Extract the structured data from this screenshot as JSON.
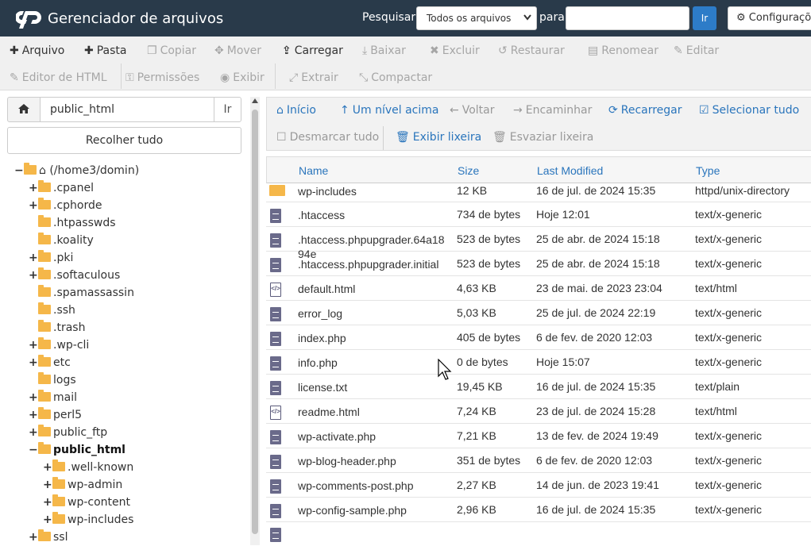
{
  "header": {
    "app_title": "Gerenciador de arquivos",
    "search_label": "Pesquisar",
    "search_scope": "Todos os arquivos",
    "for_label": "para",
    "search_value": "",
    "go_label": "Ir",
    "settings_label": "Configurações"
  },
  "toolbar": {
    "row1": [
      {
        "label": "Arquivo",
        "icon": "plus-icon",
        "enabled": true
      },
      {
        "label": "Pasta",
        "icon": "plus-icon",
        "enabled": true
      },
      {
        "label": "Copiar",
        "icon": "copy-icon",
        "enabled": false
      },
      {
        "label": "Mover",
        "icon": "move-icon",
        "enabled": false
      },
      {
        "label": "Carregar",
        "icon": "upload-icon",
        "enabled": true
      },
      {
        "label": "Baixar",
        "icon": "download-icon",
        "enabled": false
      },
      {
        "label": "Excluir",
        "icon": "times-icon",
        "enabled": false
      },
      {
        "label": "Restaurar",
        "icon": "undo-icon",
        "enabled": false
      },
      {
        "label": "Renomear",
        "icon": "file-icon",
        "enabled": false
      },
      {
        "label": "Editar",
        "icon": "pencil-icon",
        "enabled": false
      }
    ],
    "row2": [
      {
        "label": "Editor de HTML",
        "icon": "edit-icon",
        "enabled": false
      },
      {
        "label": "Permissões",
        "icon": "key-icon",
        "enabled": false
      },
      {
        "label": "Exibir",
        "icon": "eye-icon",
        "enabled": false
      },
      {
        "label": "Extrair",
        "icon": "expand-icon",
        "enabled": false
      },
      {
        "label": "Compactar",
        "icon": "compress-icon",
        "enabled": false
      }
    ]
  },
  "left_panel": {
    "path_value": "public_html",
    "go_label": "Ir",
    "collapse_label": "Recolher tudo",
    "tree": [
      {
        "label": "(/home3/domin)",
        "toggle": "−",
        "root": true
      },
      {
        "label": ".cpanel",
        "toggle": "+"
      },
      {
        "label": ".cphorde",
        "toggle": "+"
      },
      {
        "label": ".htpasswds",
        "toggle": ""
      },
      {
        "label": ".koality",
        "toggle": ""
      },
      {
        "label": ".pki",
        "toggle": "+"
      },
      {
        "label": ".softaculous",
        "toggle": "+"
      },
      {
        "label": ".spamassassin",
        "toggle": ""
      },
      {
        "label": ".ssh",
        "toggle": ""
      },
      {
        "label": ".trash",
        "toggle": ""
      },
      {
        "label": ".wp-cli",
        "toggle": "+"
      },
      {
        "label": "etc",
        "toggle": "+"
      },
      {
        "label": "logs",
        "toggle": ""
      },
      {
        "label": "mail",
        "toggle": "+"
      },
      {
        "label": "perl5",
        "toggle": "+"
      },
      {
        "label": "public_ftp",
        "toggle": "+"
      },
      {
        "label": "public_html",
        "toggle": "−",
        "selected": true
      },
      {
        "label": ".well-known",
        "toggle": "+",
        "child": true
      },
      {
        "label": "wp-admin",
        "toggle": "+",
        "child": true
      },
      {
        "label": "wp-content",
        "toggle": "+",
        "child": true
      },
      {
        "label": "wp-includes",
        "toggle": "+",
        "child": true
      },
      {
        "label": "ssl",
        "toggle": "+"
      }
    ]
  },
  "actions": {
    "home": "Início",
    "up": "Um nível acima",
    "back": "Voltar",
    "forward": "Encaminhar",
    "reload": "Recarregar",
    "select_all": "Selecionar tudo",
    "deselect_all": "Desmarcar tudo",
    "view_trash": "Exibir lixeira",
    "empty_trash": "Esvaziar lixeira"
  },
  "table": {
    "headers": {
      "name": "Name",
      "size": "Size",
      "modified": "Last Modified",
      "type": "Type"
    },
    "rows": [
      {
        "name": "wp-includes",
        "size": "12 KB",
        "modified": "16 de jul. de 2024 15:35",
        "type": "httpd/unix-directory",
        "icon": "folder"
      },
      {
        "name": ".htaccess",
        "size": "734 de bytes",
        "modified": "Hoje 12:01",
        "type": "text/x-generic",
        "icon": "doc"
      },
      {
        "name": ".htaccess.phpupgrader.64a1894e",
        "size": "523 de bytes",
        "modified": "25 de abr. de 2024 15:18",
        "type": "text/x-generic",
        "icon": "doc"
      },
      {
        "name": ".htaccess.phpupgrader.initial",
        "size": "523 de bytes",
        "modified": "25 de abr. de 2024 15:18",
        "type": "text/x-generic",
        "icon": "doc"
      },
      {
        "name": "default.html",
        "size": "4,63 KB",
        "modified": "23 de mai. de 2023 23:04",
        "type": "text/html",
        "icon": "html"
      },
      {
        "name": "error_log",
        "size": "5,03 KB",
        "modified": "25 de jul. de 2024 22:19",
        "type": "text/x-generic",
        "icon": "doc"
      },
      {
        "name": "index.php",
        "size": "405 de bytes",
        "modified": "6 de fev. de 2020 12:03",
        "type": "text/x-generic",
        "icon": "doc"
      },
      {
        "name": "info.php",
        "size": "0 de bytes",
        "modified": "Hoje 15:07",
        "type": "text/x-generic",
        "icon": "doc"
      },
      {
        "name": "license.txt",
        "size": "19,45 KB",
        "modified": "16 de jul. de 2024 15:35",
        "type": "text/plain",
        "icon": "doc"
      },
      {
        "name": "readme.html",
        "size": "7,24 KB",
        "modified": "23 de jul. de 2024 15:28",
        "type": "text/html",
        "icon": "html"
      },
      {
        "name": "wp-activate.php",
        "size": "7,21 KB",
        "modified": "13 de fev. de 2024 19:49",
        "type": "text/x-generic",
        "icon": "doc"
      },
      {
        "name": "wp-blog-header.php",
        "size": "351 de bytes",
        "modified": "6 de fev. de 2020 12:03",
        "type": "text/x-generic",
        "icon": "doc"
      },
      {
        "name": "wp-comments-post.php",
        "size": "2,27 KB",
        "modified": "14 de jun. de 2023 19:41",
        "type": "text/x-generic",
        "icon": "doc"
      },
      {
        "name": "wp-config-sample.php",
        "size": "2,96 KB",
        "modified": "16 de jul. de 2024 15:35",
        "type": "text/x-generic",
        "icon": "doc"
      }
    ]
  }
}
